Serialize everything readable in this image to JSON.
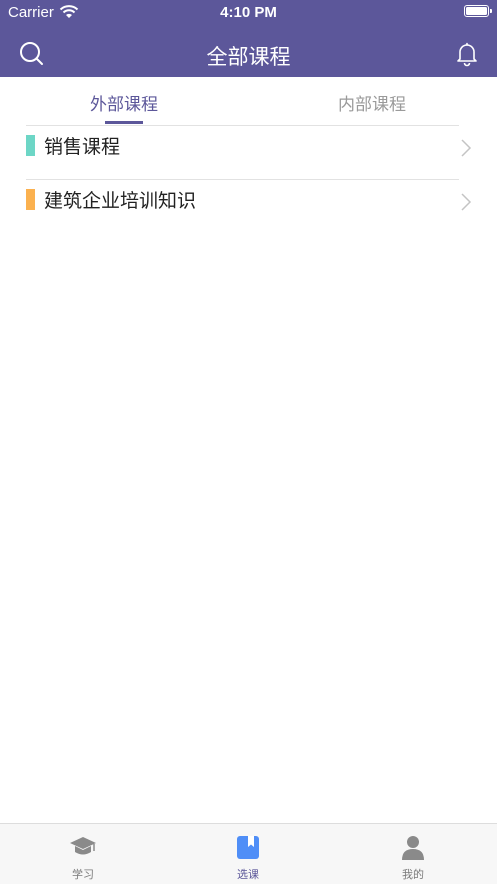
{
  "status_bar": {
    "carrier": "Carrier",
    "time": "4:10 PM"
  },
  "nav": {
    "title": "全部课程",
    "left_icon": "search-icon",
    "right_icon": "bell-icon"
  },
  "tabs": [
    {
      "label": "外部课程",
      "selected": true
    },
    {
      "label": "内部课程",
      "selected": false
    }
  ],
  "categories": [
    {
      "label": "销售课程",
      "color": "#6dd6c6"
    },
    {
      "label": "建筑企业培训知识",
      "color": "#fbb14f"
    }
  ],
  "tab_bar": [
    {
      "label": "学习",
      "icon": "graduation-cap-icon",
      "active": false
    },
    {
      "label": "选课",
      "icon": "book-icon",
      "active": true
    },
    {
      "label": "我的",
      "icon": "person-icon",
      "active": false
    }
  ],
  "colors": {
    "primary": "#5c579a",
    "active_tab_icon": "#4f8ef7",
    "inactive_icon": "#8a8a8a"
  }
}
